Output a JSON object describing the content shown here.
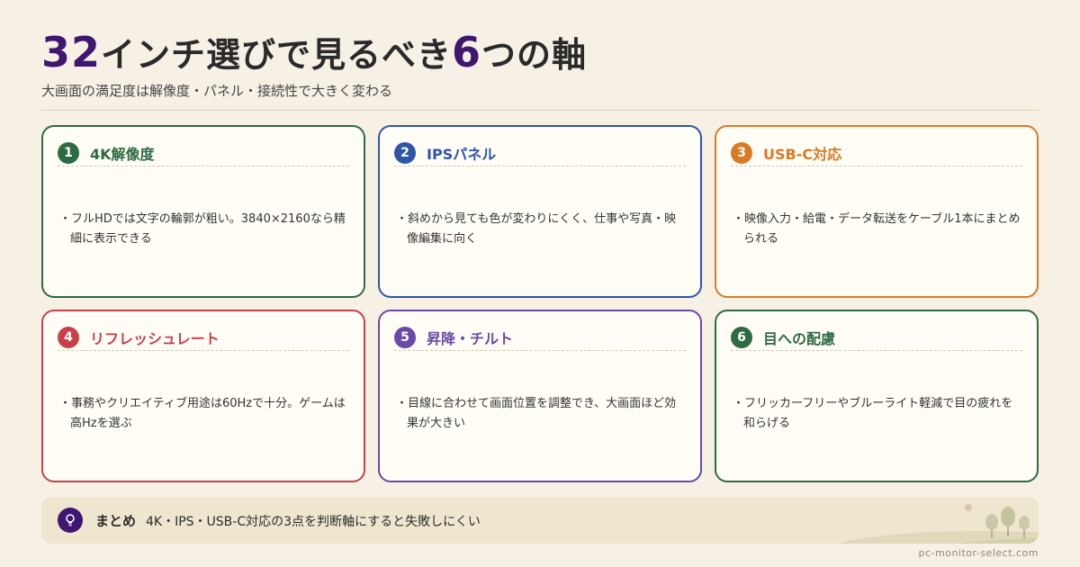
{
  "header": {
    "title_num1": "32",
    "title_mid": "インチ選びで見るべき",
    "title_num2": "6",
    "title_end": "つの軸",
    "subtitle": "大画面の満足度は解像度・パネル・接続性で大きく変わる"
  },
  "cards": [
    {
      "num": "1",
      "title": "4K解像度",
      "text": "・フルHDでは文字の輪郭が粗い。3840×2160なら精細に表示できる",
      "color": "#2e6b43"
    },
    {
      "num": "2",
      "title": "IPSパネル",
      "text": "・斜めから見ても色が変わりにくく、仕事や写真・映像編集に向く",
      "color": "#2f56a8"
    },
    {
      "num": "3",
      "title": "USB-C対応",
      "text": "・映像入力・給電・データ転送をケーブル1本にまとめられる",
      "color": "#d97b26"
    },
    {
      "num": "4",
      "title": "リフレッシュレート",
      "text": "・事務やクリエイティブ用途は60Hzで十分。ゲームは高Hzを選ぶ",
      "color": "#c8414a"
    },
    {
      "num": "5",
      "title": "昇降・チルト",
      "text": "・目線に合わせて画面位置を調整でき、大画面ほど効果が大きい",
      "color": "#6a4aa8"
    },
    {
      "num": "6",
      "title": "目への配慮",
      "text": "・フリッカーフリーやブルーライト軽減で目の疲れを和らげる",
      "color": "#2e6b43"
    }
  ],
  "summary": {
    "label": "まとめ",
    "text": "4K・IPS・USB-C対応の3点を判断軸にすると失敗しにくい",
    "icon": "lightbulb-icon"
  },
  "footer": {
    "url": "pc-monitor-select.com"
  },
  "colors": {
    "background": "#f6f1e4",
    "accent": "#3f1670"
  }
}
